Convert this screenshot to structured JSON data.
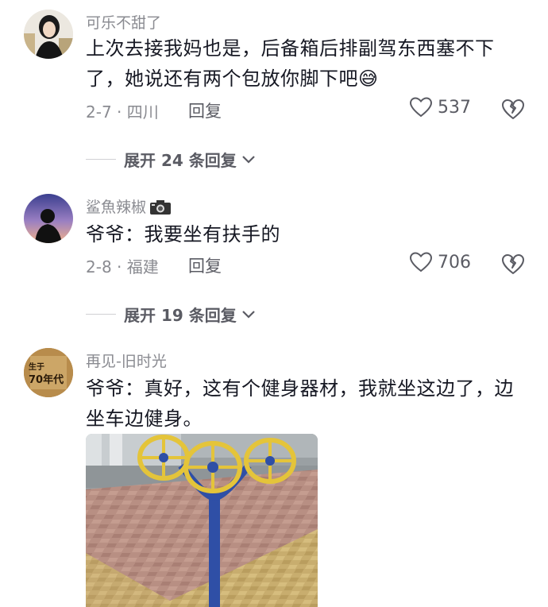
{
  "comments": [
    {
      "username": "可乐不甜了",
      "text": "上次去接我妈也是，后备箱后排副驾东西塞不下了，她说还有两个包放你脚下吧",
      "emoji": "😅",
      "date_location": "2-7 · 四川",
      "reply_label": "回复",
      "likes": "537",
      "expand_label": "展开 24 条回复"
    },
    {
      "username": "鲨魚辣椒",
      "username_icon": "camera-icon",
      "text": "爷爷：我要坐有扶手的",
      "date_location": "2-8 · 福建",
      "reply_label": "回复",
      "likes": "706",
      "expand_label": "展开 19 条回复"
    },
    {
      "username": "再见-旧时光",
      "text": "爷爷：真好，这有个健身器材，我就坐这边了，边坐车边健身。",
      "avatar_text_top": "生于",
      "avatar_text_main": "70年代",
      "has_image": true
    }
  ],
  "colors": {
    "primary_text": "#161823",
    "secondary_text": "#8a8b91",
    "action_text": "#5a5b63",
    "divider": "#d0d0d4"
  }
}
